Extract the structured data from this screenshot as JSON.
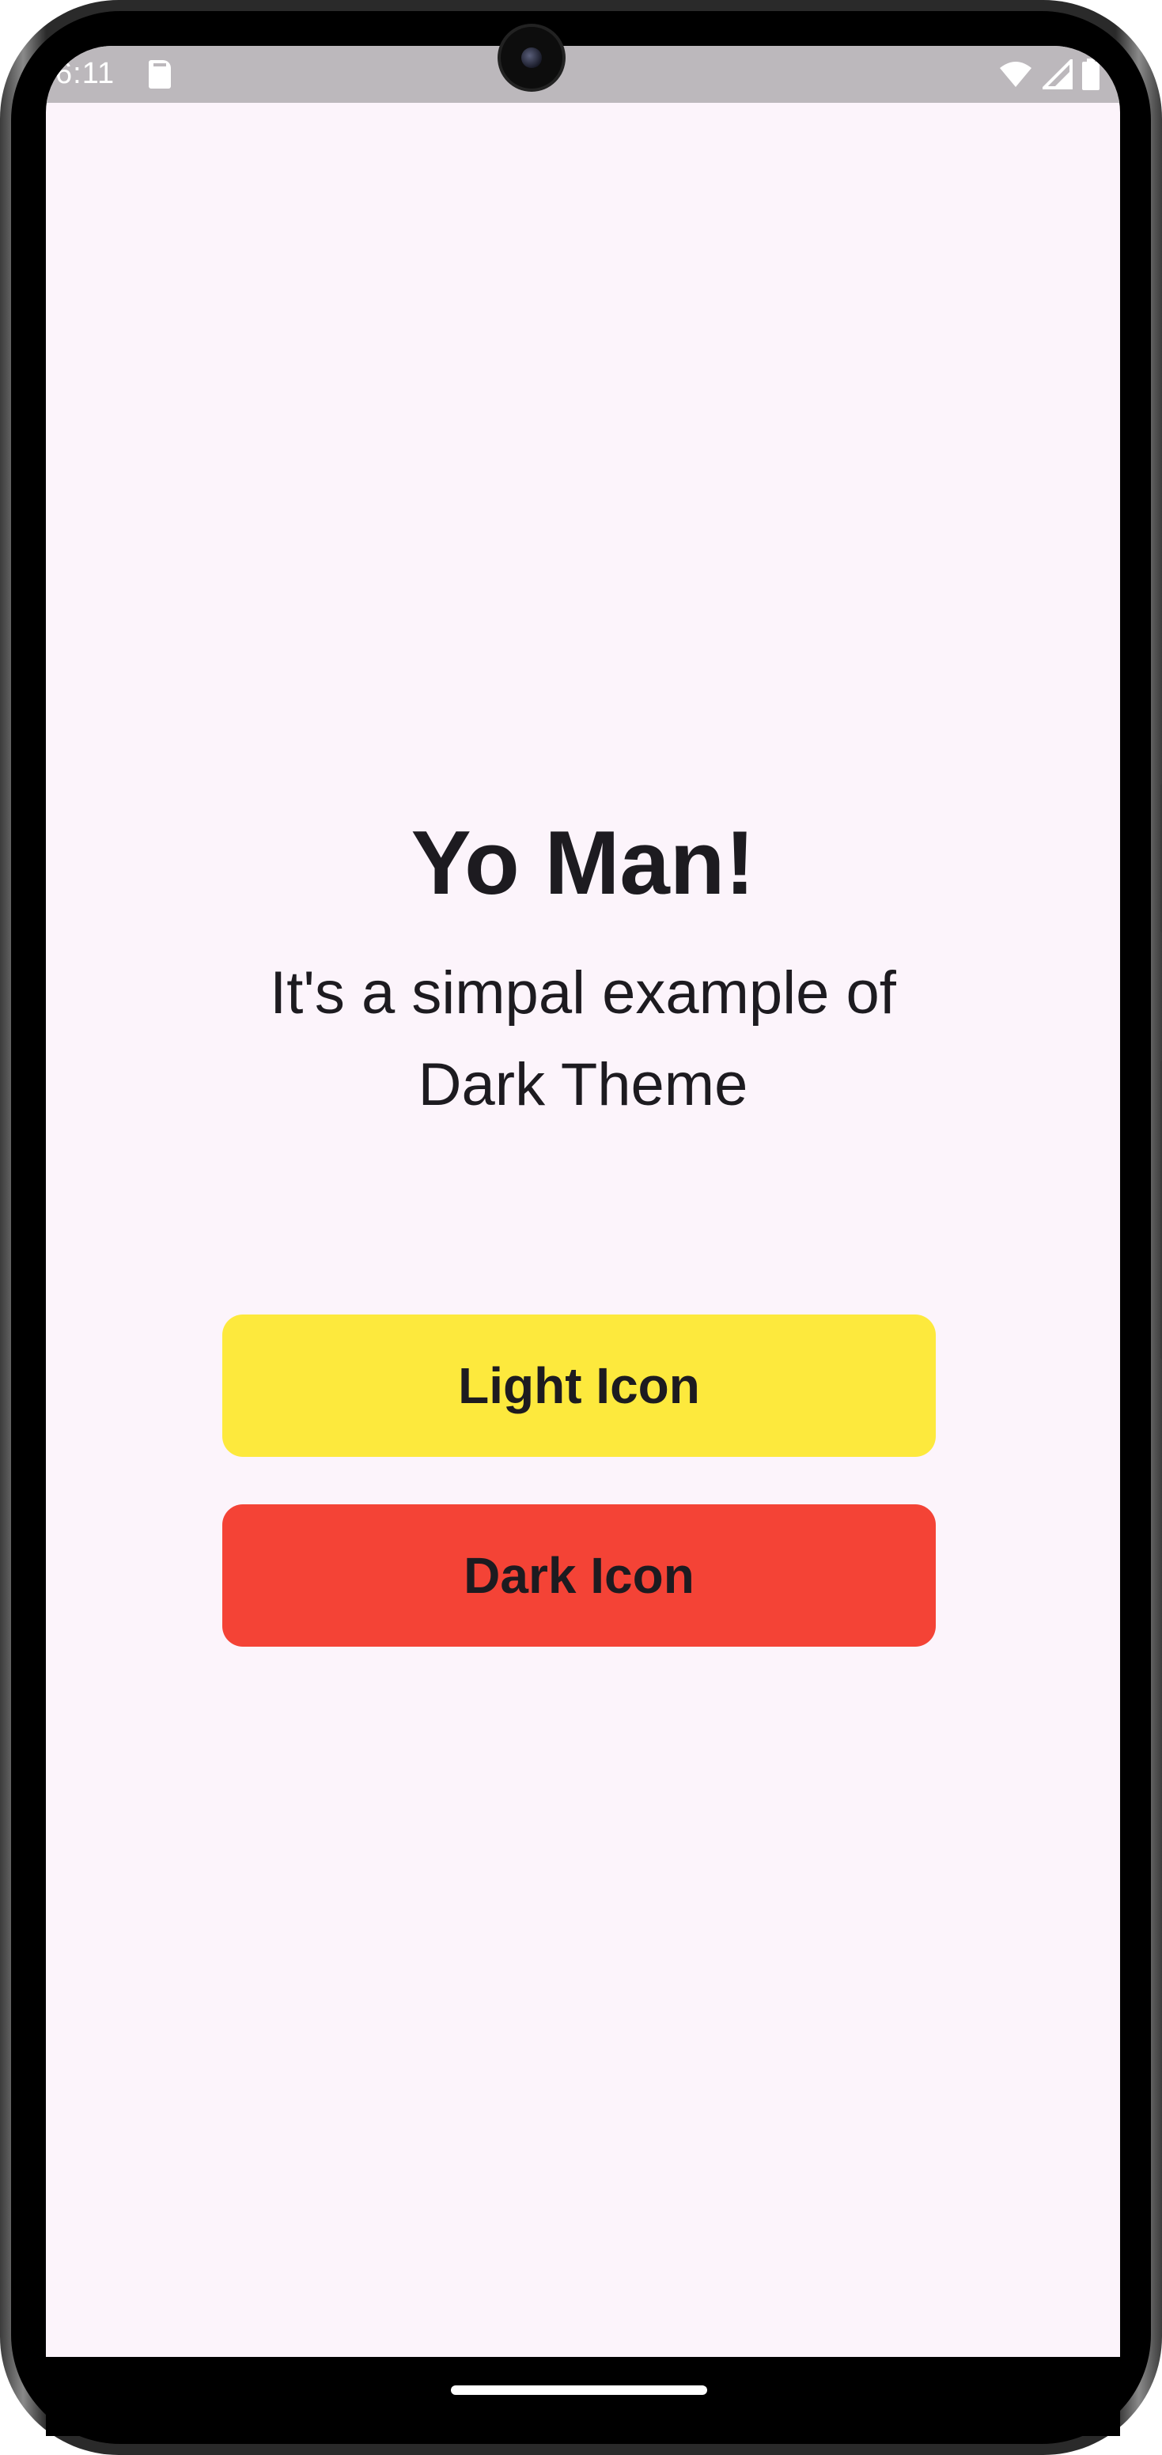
{
  "status_bar": {
    "time": "6:11",
    "icons": [
      "sd-card-icon",
      "wifi-icon",
      "signal-icon",
      "battery-icon"
    ]
  },
  "main": {
    "title": "Yo Man!",
    "subtitle": "It's a simpal example of Dark Theme",
    "buttons": [
      {
        "label": "Light Icon",
        "color": "#fde93d"
      },
      {
        "label": "Dark Icon",
        "color": "#f44336"
      }
    ]
  },
  "colors": {
    "background": "#fcf4fb",
    "status_bar": "#bcb8bc",
    "text": "#1d1b20"
  }
}
